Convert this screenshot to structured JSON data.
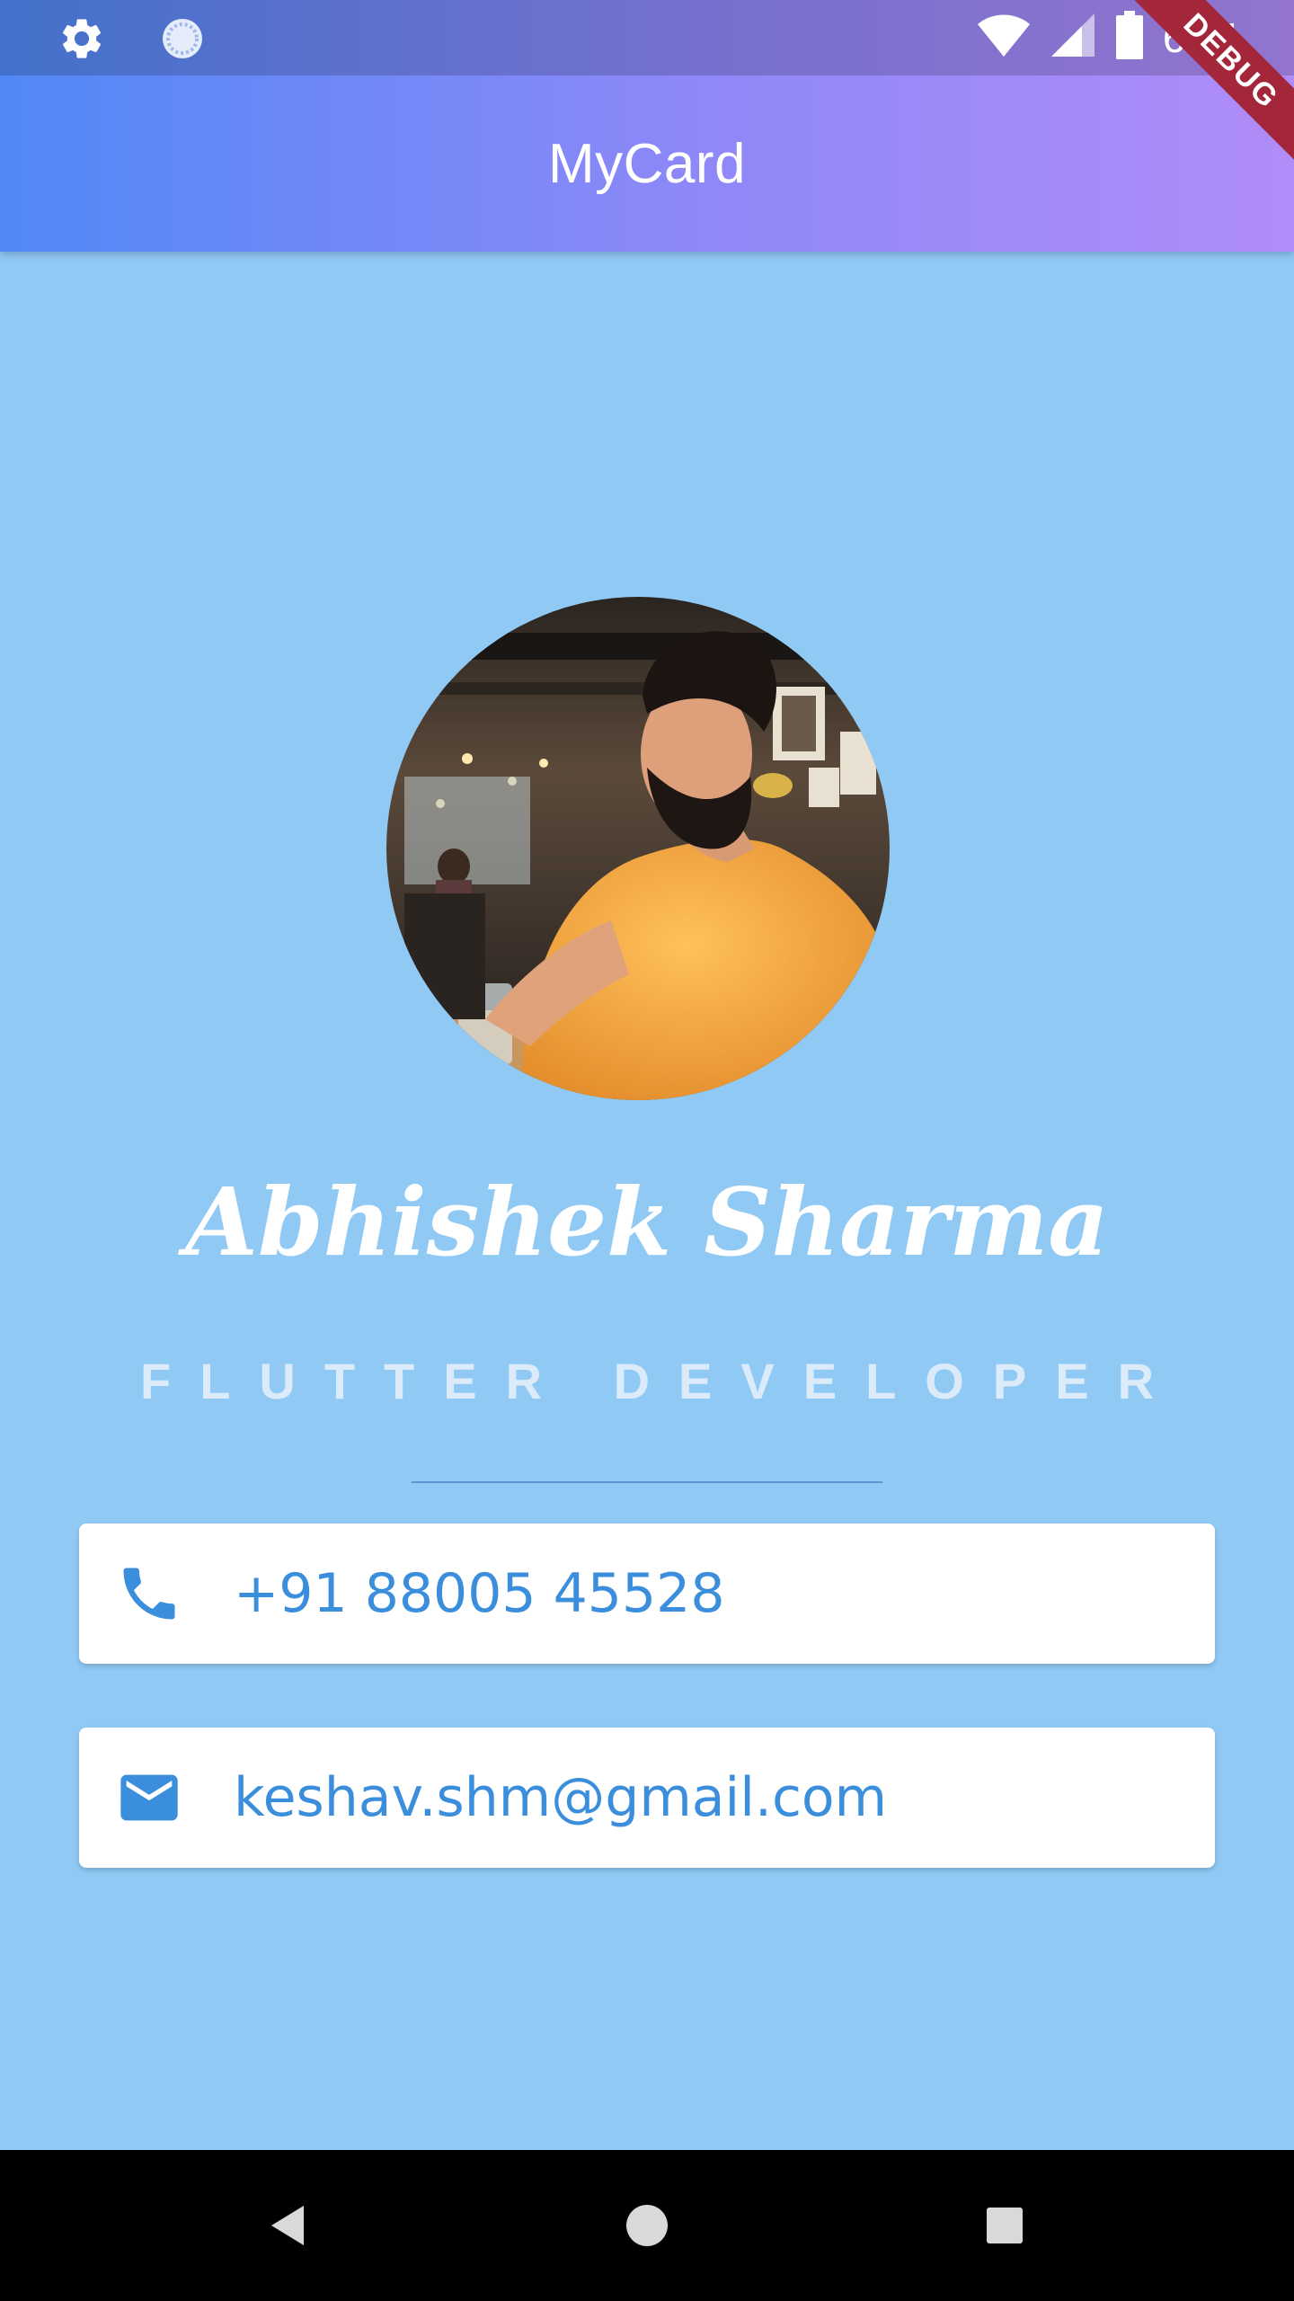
{
  "status_bar": {
    "time": "6:11",
    "icons": [
      "settings-icon",
      "sync-icon",
      "wifi-icon",
      "signal-icon",
      "battery-icon"
    ]
  },
  "app_bar": {
    "title": "MyCard"
  },
  "debug_banner": "DEBUG",
  "profile": {
    "name": "Abhishek Sharma",
    "title": "FLUTTER DEVELOPER"
  },
  "contacts": {
    "phone": {
      "icon": "phone-icon",
      "value": "+91 88005 45528"
    },
    "email": {
      "icon": "mail-icon",
      "value": "keshav.shm@gmail.com"
    }
  },
  "nav_bar": {
    "buttons": [
      "back-icon",
      "home-icon",
      "recents-icon"
    ]
  },
  "colors": {
    "background": "#91C9F5",
    "app_bar_gradient_start": "#5188F5",
    "app_bar_gradient_end": "#B08CF8",
    "accent_text": "#3A8EDB",
    "debug_ribbon": "#A4263A"
  }
}
